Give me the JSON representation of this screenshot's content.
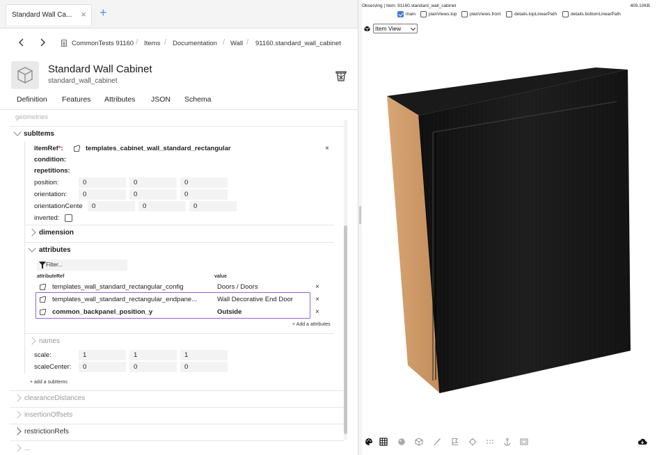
{
  "tab": {
    "label": "Standard Wall Ca...",
    "close": "×",
    "add": "+"
  },
  "breadcrumb": {
    "items": [
      "CommonTests 91160",
      "Items",
      "Documentation",
      "Wall",
      "91160.standard_wall_cabinet"
    ],
    "separator": "/"
  },
  "header": {
    "title": "Standard Wall Cabinet",
    "subtitle": "standard_wall_cabinet"
  },
  "nav": {
    "tabs": [
      "Definition",
      "Features",
      "Attributes",
      "JSON",
      "Schema"
    ]
  },
  "tree": {
    "faded_top": "geometries",
    "subitems_label": "subItems",
    "item": {
      "itemRef_label": "itemRef",
      "itemRef_required": "*",
      "itemRef_colon": ":",
      "itemRef_value": "templates_cabinet_wall_standard_rectangular",
      "condition_label": "condition:",
      "repetitions_label": "repetitions:",
      "position_label": "position:",
      "position": [
        "0",
        "0",
        "0"
      ],
      "orientation_label": "orientation:",
      "orientation": [
        "0",
        "0",
        "0"
      ],
      "orientationCenter_label": "orientationCente",
      "orientationCenter": [
        "0",
        "0",
        "0"
      ],
      "inverted_label": "inverted:",
      "dimension_label": "dimension",
      "attributes_label": "attributes",
      "filter_placeholder": "Filter...",
      "col_ref": "attributeRef",
      "col_value": "value",
      "attributes": [
        {
          "ref": "templates_wall_standard_rectangular_config",
          "value": "Doors / Doors",
          "bold": false
        },
        {
          "ref": "templates_wall_standard_rectangular_endpane...",
          "value": "Wall Decorative End Door",
          "bold": false
        },
        {
          "ref": "common_backpanel_position_y",
          "value": "Outside",
          "bold": true
        }
      ],
      "add_attributes": "+ Add a attributes",
      "names_label": "names",
      "scale_label": "scale:",
      "scale": [
        "1",
        "1",
        "1"
      ],
      "scaleCenter_label": "scaleCenter:",
      "scaleCenter": [
        "0",
        "0",
        "0"
      ]
    },
    "add_subitems": "+ add a subItems",
    "bottom_sections": [
      "clearanceDistances",
      "insertionOffsets",
      "restrictionRefs"
    ],
    "cut_section": "..."
  },
  "viewer": {
    "observing": "Observing | Item: 91160.standard_wall_cabinet",
    "filesize": "409.10KB",
    "layers": [
      {
        "label": "main",
        "checked": true
      },
      {
        "label": "planViews.top",
        "checked": false
      },
      {
        "label": "planViews.front",
        "checked": false
      },
      {
        "label": "details.topLinearPath",
        "checked": false
      },
      {
        "label": "details.bottomLinearPath",
        "checked": false
      }
    ],
    "view_mode": "Item View",
    "toolbar_icons": [
      "palette-icon",
      "grid-icon",
      "sphere-icon",
      "box-icon",
      "brush-icon",
      "bounding-box-icon",
      "target-icon",
      "dots-grid-icon",
      "anchor-icon",
      "image-icon",
      "cloud-download-icon"
    ],
    "colors": {
      "accent": "#3d7bd9",
      "highlight": "#9a5fd6",
      "wood_side": "#d2a06e",
      "door": "#151515"
    }
  }
}
